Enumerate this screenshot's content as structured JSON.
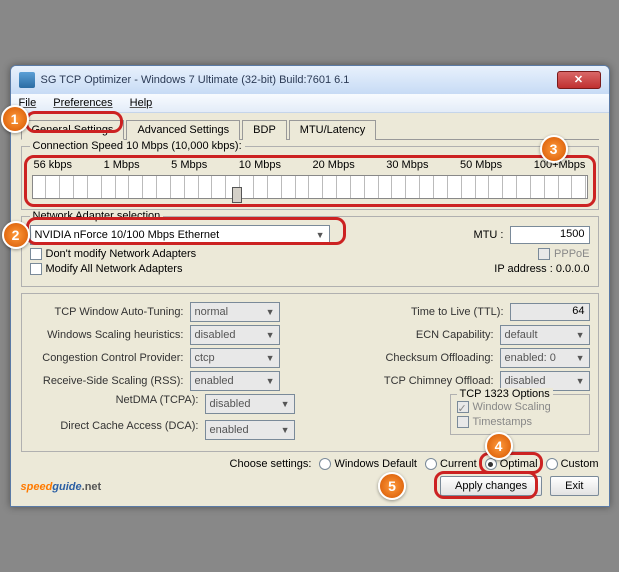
{
  "title": "SG TCP Optimizer - Windows 7 Ultimate (32-bit) Build:7601 6.1",
  "menu": {
    "file": "File",
    "preferences": "Preferences",
    "help": "Help"
  },
  "tabs": {
    "general": "General Settings",
    "advanced": "Advanced Settings",
    "bdp": "BDP",
    "mtu": "MTU/Latency"
  },
  "speed": {
    "group_label": "Connection Speed  10 Mbps (10,000 kbps):",
    "ticks": [
      "56 kbps",
      "1 Mbps",
      "5 Mbps",
      "10 Mbps",
      "20 Mbps",
      "30 Mbps",
      "50 Mbps",
      "100+Mbps"
    ]
  },
  "adapter": {
    "group_label": "Network Adapter selection",
    "selected": "NVIDIA nForce 10/100 Mbps Ethernet",
    "dont_modify": "Don't modify Network Adapters",
    "modify_all": "Modify All Network Adapters",
    "mtu_label": "MTU :",
    "mtu_value": "1500",
    "pppoe": "PPPoE",
    "ip_label": "IP address : 0.0.0.0"
  },
  "settings": {
    "auto_tuning_label": "TCP Window Auto-Tuning:",
    "auto_tuning": "normal",
    "heuristics_label": "Windows Scaling heuristics:",
    "heuristics": "disabled",
    "congestion_label": "Congestion Control Provider:",
    "congestion": "ctcp",
    "rss_label": "Receive-Side Scaling (RSS):",
    "rss": "enabled",
    "netdma_label": "NetDMA (TCPA):",
    "netdma": "disabled",
    "dca_label": "Direct Cache Access (DCA):",
    "dca": "enabled",
    "ttl_label": "Time to Live (TTL):",
    "ttl": "64",
    "ecn_label": "ECN Capability:",
    "ecn": "default",
    "chksum_label": "Checksum Offloading:",
    "chksum": "enabled: 0",
    "chimney_label": "TCP Chimney Offload:",
    "chimney": "disabled",
    "tcp1323_title": "TCP 1323 Options",
    "window_scaling": "Window Scaling",
    "timestamps": "Timestamps"
  },
  "bottom": {
    "choose": "Choose settings:",
    "default": "Windows Default",
    "current": "Current",
    "optimal": "Optimal",
    "custom": "Custom",
    "apply": "Apply changes",
    "exit": "Exit"
  },
  "callouts": {
    "c1": "1",
    "c2": "2",
    "c3": "3",
    "c4": "4",
    "c5": "5"
  }
}
